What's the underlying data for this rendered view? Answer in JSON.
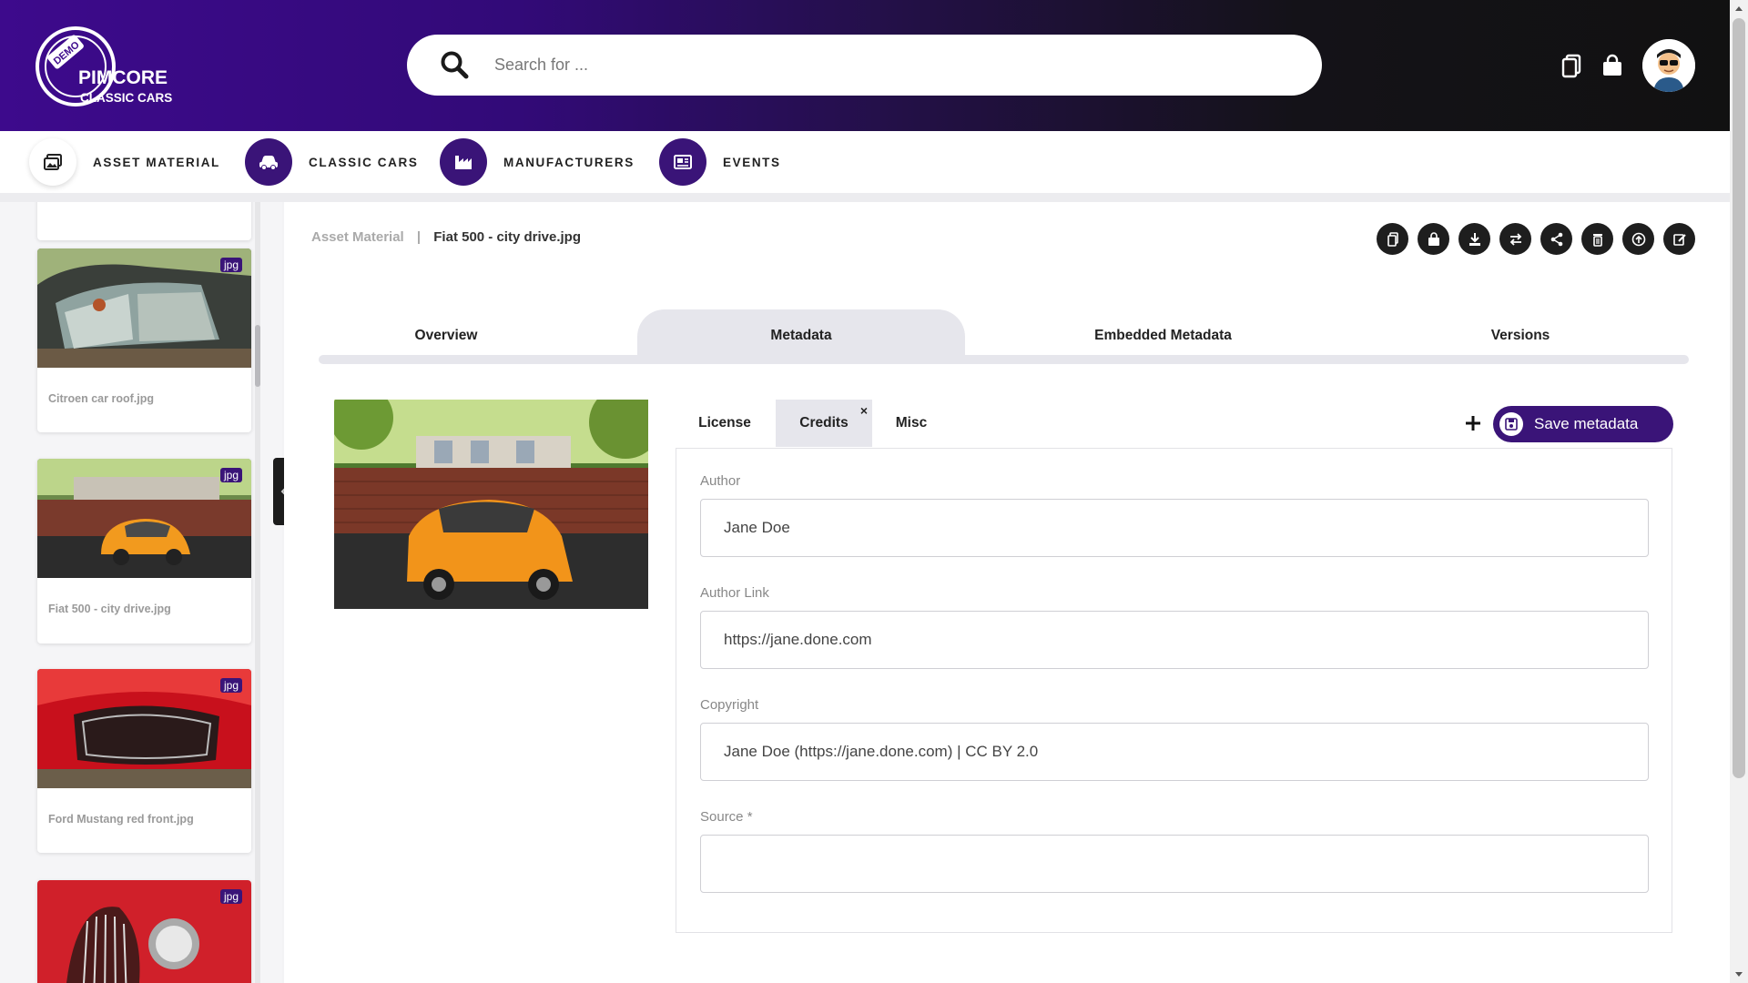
{
  "header": {
    "logo_badge": "DEMO",
    "logo_brand": "PIMCORE",
    "logo_sub": "CLASSIC CARS",
    "search_placeholder": "Search for ..."
  },
  "nav": {
    "items": [
      {
        "label": "ASSET MATERIAL",
        "icon": "images-icon",
        "active": true
      },
      {
        "label": "CLASSIC CARS",
        "icon": "car-icon",
        "active": false
      },
      {
        "label": "MANUFACTURERS",
        "icon": "factory-icon",
        "active": false
      },
      {
        "label": "EVENTS",
        "icon": "newspaper-icon",
        "active": false
      }
    ]
  },
  "sidebar": {
    "cards": [
      {
        "name": "Citroen car roof.jpg",
        "badge": "jpg"
      },
      {
        "name": "Fiat 500 - city drive.jpg",
        "badge": "jpg"
      },
      {
        "name": "Ford Mustang red front.jpg",
        "badge": "jpg"
      },
      {
        "name": "",
        "badge": "jpg"
      }
    ]
  },
  "breadcrumb": {
    "root": "Asset Material",
    "separator": "|",
    "current": "Fiat 500 - city drive.jpg"
  },
  "toolbar": [
    "copy-icon",
    "bag-icon",
    "download-icon",
    "swap-icon",
    "share-icon",
    "trash-icon",
    "upload-icon",
    "edit-icon"
  ],
  "tabs": [
    {
      "label": "Overview"
    },
    {
      "label": "Metadata",
      "active": true
    },
    {
      "label": "Embedded Metadata"
    },
    {
      "label": "Versions"
    }
  ],
  "subtabs": [
    {
      "label": "License"
    },
    {
      "label": "Credits",
      "active": true,
      "close": "×"
    },
    {
      "label": "Misc"
    }
  ],
  "save_label": "Save metadata",
  "fields": [
    {
      "label": "Author",
      "value": "Jane Doe"
    },
    {
      "label": "Author Link",
      "value": "https://jane.done.com"
    },
    {
      "label": "Copyright",
      "value": "Jane Doe (https://jane.done.com) | CC BY 2.0"
    },
    {
      "label": "Source *",
      "value": ""
    }
  ],
  "colors": {
    "brand": "#3a1478",
    "header_start": "#3d0a8c",
    "header_end": "#111111"
  }
}
